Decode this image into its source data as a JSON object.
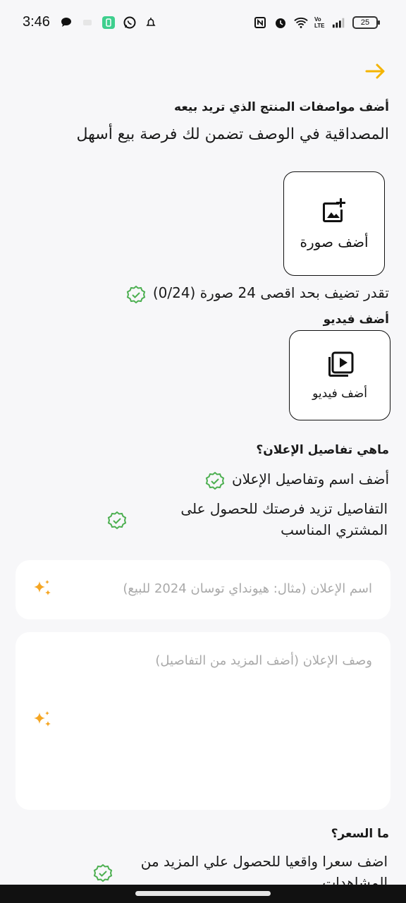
{
  "status": {
    "time": "3:46",
    "battery": "25",
    "volte": "Vo LTE"
  },
  "colors": {
    "accent": "#f4b400",
    "check": "#4caf50",
    "sparkle": "#f5a623"
  },
  "header": {
    "back_icon": "arrow-right-icon"
  },
  "product": {
    "title": "أضف مواصفات المنتج الذي تريد بيعه",
    "subtitle": "المصداقية في الوصف تضمن لك فرصة بيع أسهل",
    "add_photo_label": "أضف صورة",
    "photo_limit_note": "تقدر تضيف بحد اقصى 24 صورة (0/24)"
  },
  "video": {
    "title": "أضف فيديو",
    "add_video_label": "أضف فيديو"
  },
  "details": {
    "title": "ماهي تفاصيل الإعلان؟",
    "tip1": "أضف اسم وتفاصيل الإعلان",
    "tip2": "التفاصيل تزيد فرصتك للحصول على المشتري المناسب"
  },
  "form": {
    "name_placeholder": "اسم الإعلان (مثال: هيونداي توسان 2024 للبيع)",
    "description_placeholder": "وصف الإعلان (أضف المزيد من التفاصيل)"
  },
  "price": {
    "title": "ما السعر؟",
    "tip": "اضف سعرا واقعيا للحصول علي المزيد من المشاهدات"
  }
}
